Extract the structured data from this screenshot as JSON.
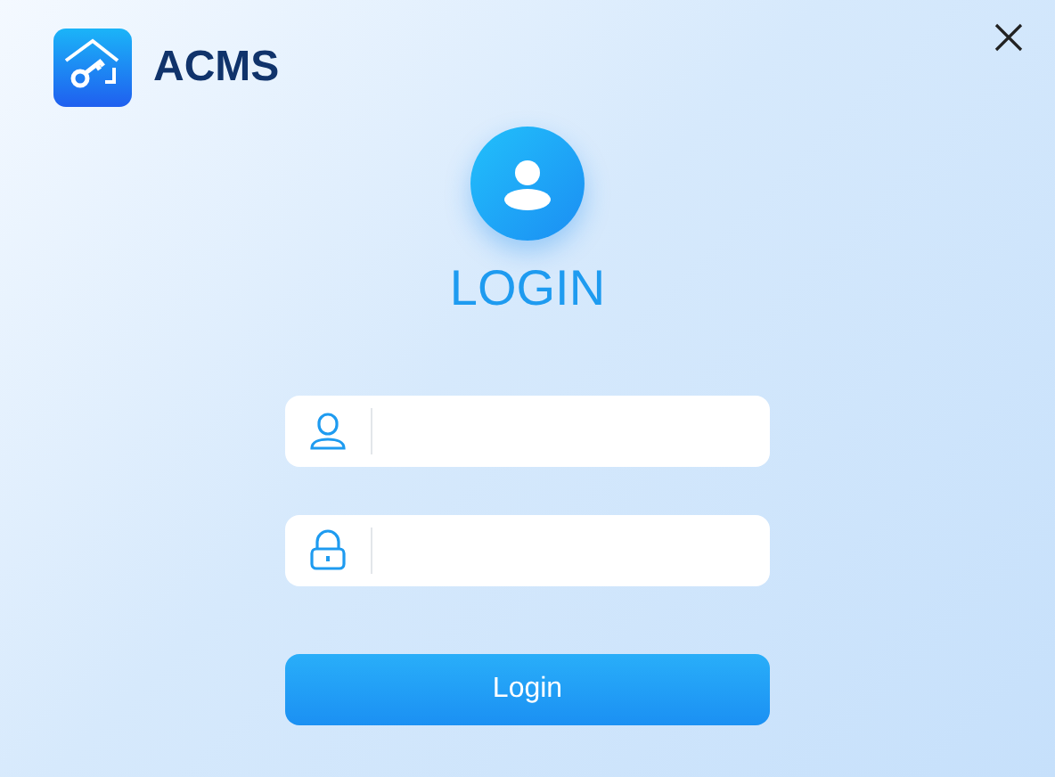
{
  "app": {
    "name": "ACMS"
  },
  "title": "LOGIN",
  "fields": [
    {
      "kind": "username"
    },
    {
      "kind": "password"
    }
  ],
  "submit": {
    "label": "Login"
  }
}
